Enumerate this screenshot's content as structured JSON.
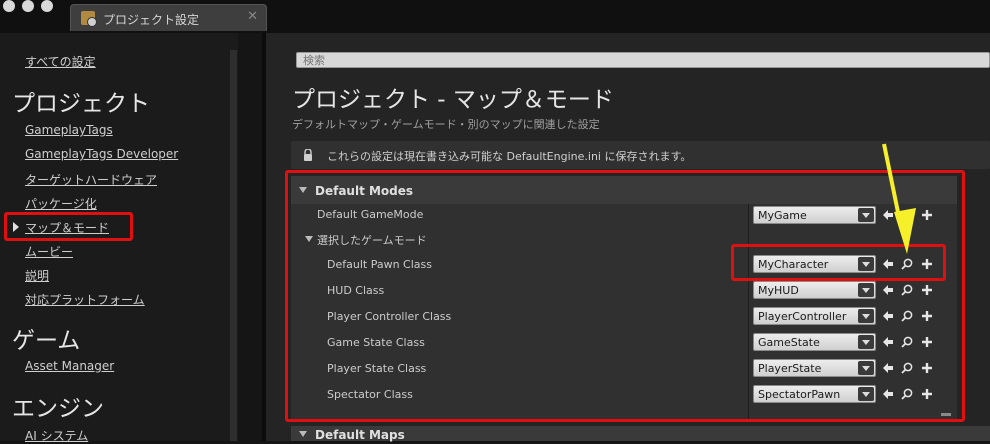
{
  "tab": {
    "label": "プロジェクト設定",
    "close": "✕"
  },
  "sidebar": {
    "all_settings": "すべての設定",
    "categories": [
      {
        "label": "プロジェクト"
      },
      {
        "label": "ゲーム"
      },
      {
        "label": "エンジン"
      }
    ],
    "items": [
      {
        "label": "GameplayTags"
      },
      {
        "label": "GameplayTags Developer"
      },
      {
        "label": "ターゲットハードウェア"
      },
      {
        "label": "パッケージ化"
      },
      {
        "label": "マップ＆モード",
        "selected": true
      },
      {
        "label": "ムービー"
      },
      {
        "label": "説明"
      },
      {
        "label": "対応プラットフォーム"
      },
      {
        "label": "Asset Manager"
      },
      {
        "label": "AI システム"
      }
    ]
  },
  "search": {
    "placeholder": "検索"
  },
  "page": {
    "title": "プロジェクト - マップ＆モード",
    "subtitle": "デフォルトマップ・ゲームモード・別のマップに関連した設定"
  },
  "notice": {
    "text": "これらの設定は現在書き込み可能な DefaultEngine.ini に保存されます。"
  },
  "default_modes": {
    "title": "Default Modes",
    "game_mode_label": "Default GameMode",
    "game_mode_value": "MyGame",
    "selected_game_mode": "選択したゲームモード",
    "rows": [
      {
        "label": "Default Pawn Class",
        "value": "MyCharacter"
      },
      {
        "label": "HUD Class",
        "value": "MyHUD"
      },
      {
        "label": "Player Controller Class",
        "value": "PlayerController"
      },
      {
        "label": "Game State Class",
        "value": "GameState"
      },
      {
        "label": "Player State Class",
        "value": "PlayerState"
      },
      {
        "label": "Spectator Class",
        "value": "SpectatorPawn"
      }
    ]
  },
  "default_maps": {
    "title": "Default Maps"
  },
  "colors": {
    "highlight": "#e01010",
    "pointer": "#f5f02a",
    "panel": "#303030"
  }
}
